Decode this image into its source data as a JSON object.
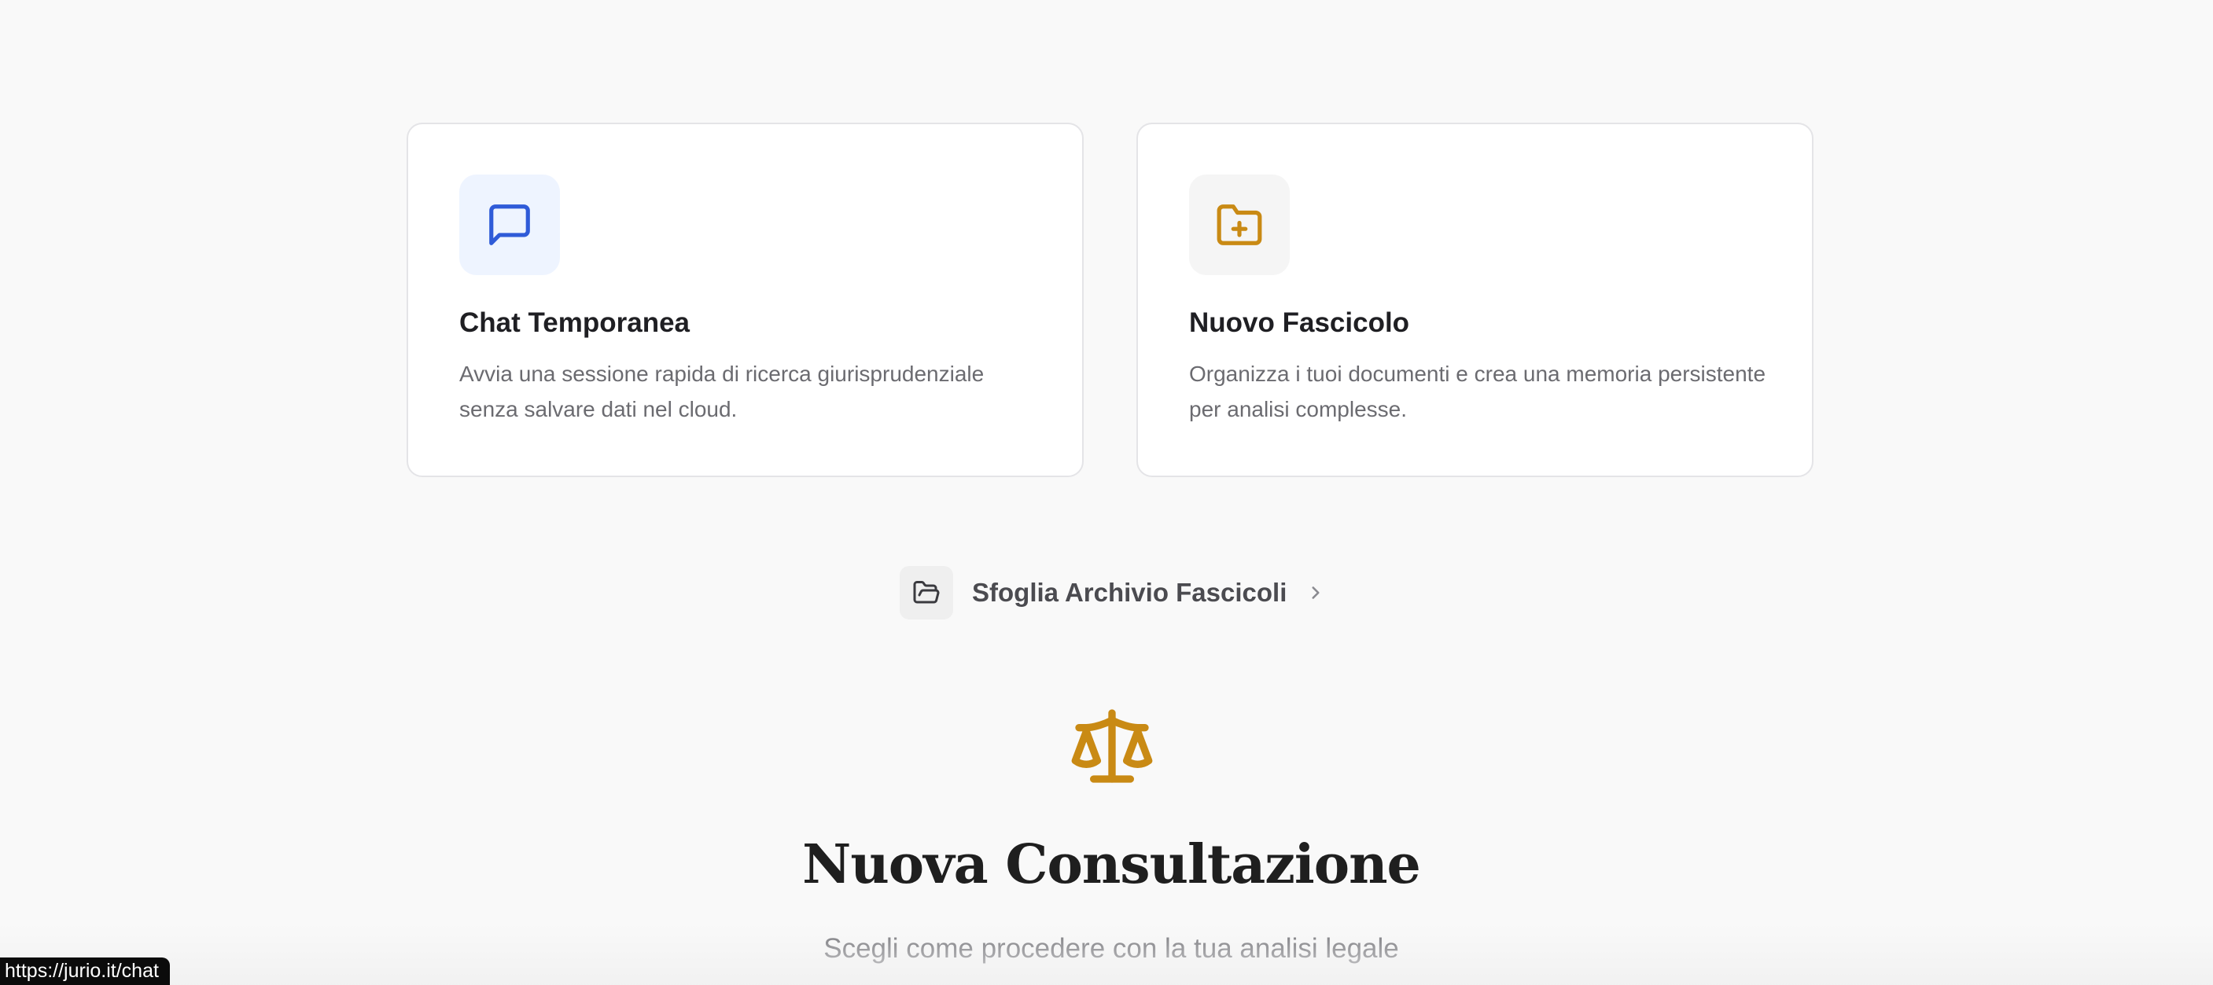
{
  "cards": [
    {
      "title": "Chat Temporanea",
      "description": "Avvia una sessione rapida di ricerca giurisprudenziale senza salvare dati nel cloud.",
      "icon": "message-square-icon",
      "icon_color": "#2f5bd8"
    },
    {
      "title": "Nuovo Fascicolo",
      "description": "Organizza i tuoi documenti e crea una memoria persistente per analisi complesse.",
      "icon": "folder-plus-icon",
      "icon_color": "#c98a14"
    }
  ],
  "archive": {
    "label": "Sfoglia Archivio Fascicoli",
    "icon": "folder-open-icon",
    "chevron": "chevron-right-icon"
  },
  "hero": {
    "icon": "scales-icon",
    "icon_color": "#c98a14",
    "title": "Nuova Consultazione",
    "subtitle": "Scegli come procedere con la tua analisi legale"
  },
  "status_bar": {
    "url": "https://jurio.it/chat"
  }
}
